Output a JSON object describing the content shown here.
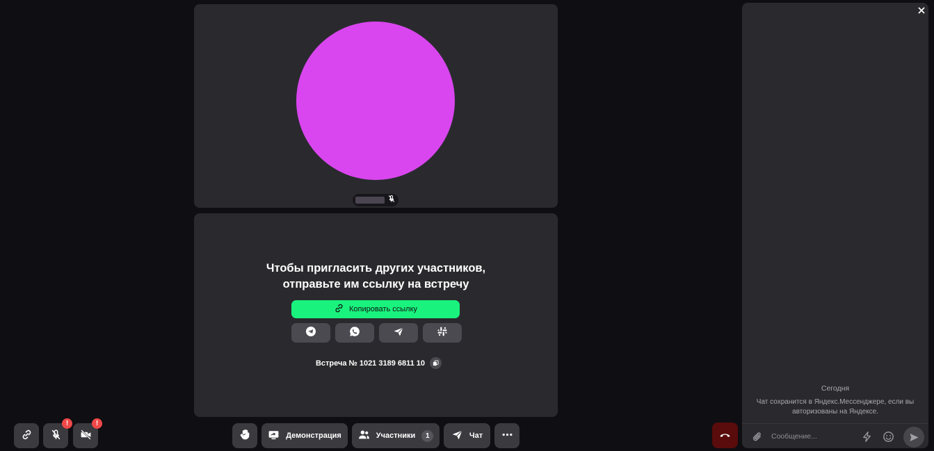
{
  "colors": {
    "background": "#0f0e12",
    "tile": "#2a2a2e",
    "avatar": "#d946ef",
    "copy_button": "#19f37e",
    "end_call": "#5a0b0b",
    "badge": "#ef4848"
  },
  "self_tile": {
    "muted_icon": "mic-off-icon"
  },
  "invite": {
    "title_line1": "Чтобы пригласить других участников,",
    "title_line2": "отправьте им ссылку на встречу",
    "copy_link_label": "Копировать ссылку",
    "share_buttons": [
      {
        "icon": "telegram-icon"
      },
      {
        "icon": "whatsapp-icon"
      },
      {
        "icon": "messenger-send-icon"
      },
      {
        "icon": "slack-icon"
      }
    ],
    "meeting_label": "Встреча № 1021 3189 6811 10"
  },
  "left_controls": {
    "link_icon": "link-icon",
    "mic_badge": "!",
    "camera_badge": "!"
  },
  "center_controls": {
    "raise_hand_icon": "hand-icon",
    "demo_label": "Демонстрация",
    "participants_label": "Участники",
    "participants_count": "1",
    "chat_label": "Чат",
    "more_icon": "more-icon"
  },
  "end_call": {
    "icon": "phone-hangup-icon"
  },
  "chat": {
    "day_label": "Сегодня",
    "notice": "Чат сохранится в Яндекс.Мессенджере, если вы авторизованы на Яндексе.",
    "input_placeholder": "Сообщение..."
  }
}
